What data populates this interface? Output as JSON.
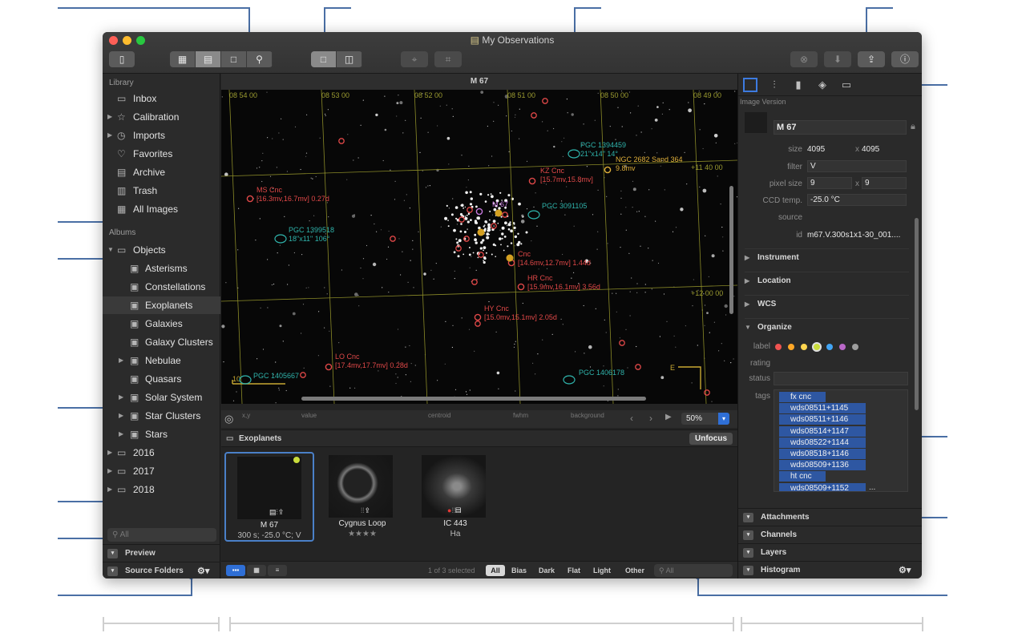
{
  "window": {
    "title": "My Observations",
    "traffic_colors": [
      "#fe5f57",
      "#febc2e",
      "#28c840"
    ]
  },
  "toolbar": {
    "sidebar_toggle_icon": "sidebar-icon",
    "view_modes": [
      "grid-icon",
      "filmstrip-icon",
      "single-icon",
      "zoom-icon"
    ],
    "layout_modes": [
      "single-pane-icon",
      "split-pane-icon"
    ],
    "actions": [
      "plate-solve-add-icon",
      "plate-solve-icon"
    ],
    "right_actions": [
      "cancel-icon",
      "download-icon",
      "share-icon",
      "info-icon"
    ]
  },
  "sidebar": {
    "library_label": "Library",
    "library": [
      {
        "label": "Inbox",
        "icon": "tray-icon"
      },
      {
        "label": "Calibration",
        "icon": "star-icon",
        "expandable": true
      },
      {
        "label": "Imports",
        "icon": "clock-icon",
        "expandable": true
      },
      {
        "label": "Favorites",
        "icon": "heart-icon"
      },
      {
        "label": "Archive",
        "icon": "archive-icon"
      },
      {
        "label": "Trash",
        "icon": "trash-icon"
      },
      {
        "label": "All Images",
        "icon": "images-icon"
      }
    ],
    "albums_label": "Albums",
    "objects_label": "Objects",
    "albums": [
      {
        "label": "Asterisms"
      },
      {
        "label": "Constellations"
      },
      {
        "label": "Exoplanets",
        "selected": true
      },
      {
        "label": "Galaxies"
      },
      {
        "label": "Galaxy Clusters"
      },
      {
        "label": "Nebulae",
        "expandable": true
      },
      {
        "label": "Quasars"
      },
      {
        "label": "Solar System",
        "expandable": true
      },
      {
        "label": "Star Clusters",
        "expandable": true
      },
      {
        "label": "Stars",
        "expandable": true
      }
    ],
    "years": [
      "2016",
      "2017",
      "2018"
    ],
    "search_placeholder": "All",
    "preview_label": "Preview",
    "source_folders_label": "Source Folders"
  },
  "viewer": {
    "image_title": "M 67",
    "ra_labels": [
      "08 54 00",
      "08 53 00",
      "08 52 00",
      "08 51 00",
      "08 50 00",
      "08 49 00"
    ],
    "dec_labels": [
      "+11 40 00",
      "+12 00 00"
    ],
    "scale_label": "10",
    "east_label": "E",
    "annotations": [
      {
        "name": "MS Cnc",
        "mag": "[16.3mv,16.7mv] 0.27d",
        "color": "#e04848"
      },
      {
        "name": "KZ Cnc",
        "mag": "[15.7mv,15.8mv]",
        "color": "#e04848"
      },
      {
        "name": "NGC 2682 Sand 364",
        "mag": "9.8mv",
        "color": "#e0b03a"
      },
      {
        "name": "PGC 1394459",
        "mag": "21\"x14\" 14°",
        "color": "#2fb3ab"
      },
      {
        "name": "PGC 3091105",
        "mag": "",
        "color": "#2fb3ab"
      },
      {
        "name": "PGC 1399518",
        "mag": "18\"x11\" 106°",
        "color": "#2fb3ab"
      },
      {
        "name": "Cnc",
        "mag": "[14.6mv,12.7mv] 1.44d",
        "color": "#e04848"
      },
      {
        "name": "HR Cnc",
        "mag": "[15.9mv,16.1mv] 3.56d",
        "color": "#e04848"
      },
      {
        "name": "HY Cnc",
        "mag": "[15.0mv,15.1mv] 2.05d",
        "color": "#e04848"
      },
      {
        "name": "LO Cnc",
        "mag": "[17.4mv,17.7mv] 0.28d",
        "color": "#e04848"
      },
      {
        "name": "PGC 1405667",
        "mag": "",
        "color": "#2fb3ab"
      },
      {
        "name": "PGC 1406178",
        "mag": "",
        "color": "#2fb3ab"
      },
      {
        "name": "M 67",
        "mag": "",
        "color": "#c678dd"
      }
    ],
    "readout_labels": [
      "x,y",
      "value",
      "centroid",
      "fwhm",
      "background"
    ],
    "zoom": "50%"
  },
  "album_bar": {
    "title": "Exoplanets",
    "unfocus_label": "Unfocus"
  },
  "thumbnails": [
    {
      "name": "M 67",
      "subtitle": "300 s; -25.0 °C; V",
      "selected": true,
      "label_color": "#c9dc3c"
    },
    {
      "name": "Cygnus Loop",
      "subtitle": "★★★★",
      "selected": false
    },
    {
      "name": "IC 443",
      "subtitle": "Ha",
      "selected": false,
      "warning": true
    }
  ],
  "filter_bar": {
    "selection_status": "1 of 3 selected",
    "filters": [
      "All",
      "Bias",
      "Dark",
      "Flat",
      "Light",
      "Other"
    ],
    "search_placeholder": "All"
  },
  "inspector": {
    "section_title": "Image Version",
    "name": "M 67",
    "size_label": "size",
    "size_w": "4095",
    "size_h": "4095",
    "filter_label": "filter",
    "filter": "V",
    "pixel_label": "pixel size",
    "pixel_w": "9",
    "pixel_h": "9",
    "ccd_label": "CCD temp.",
    "ccd": "-25.0 °C",
    "source_label": "source",
    "id_label": "id",
    "id": "m67.V.300s1x1-30_001....",
    "x_sep": "x",
    "sections": [
      "Instrument",
      "Location",
      "WCS",
      "Organize"
    ],
    "label_label": "label",
    "label_colors": [
      "#ef5350",
      "#ffa726",
      "#ffd54f",
      "#c9dc3c",
      "#42a5f5",
      "#ba68c8",
      "#9e9e9e"
    ],
    "rating_label": "rating",
    "status_label": "status",
    "tags_label": "tags",
    "tags": [
      "fx cnc",
      "wds08511+1145",
      "wds08511+1146",
      "wds08514+1147",
      "wds08522+1144",
      "wds08518+1146",
      "wds08509+1136",
      "ht cnc",
      "wds08509+1152"
    ],
    "tags_more": "...",
    "footer": [
      "Attachments",
      "Channels",
      "Layers",
      "Histogram"
    ]
  }
}
